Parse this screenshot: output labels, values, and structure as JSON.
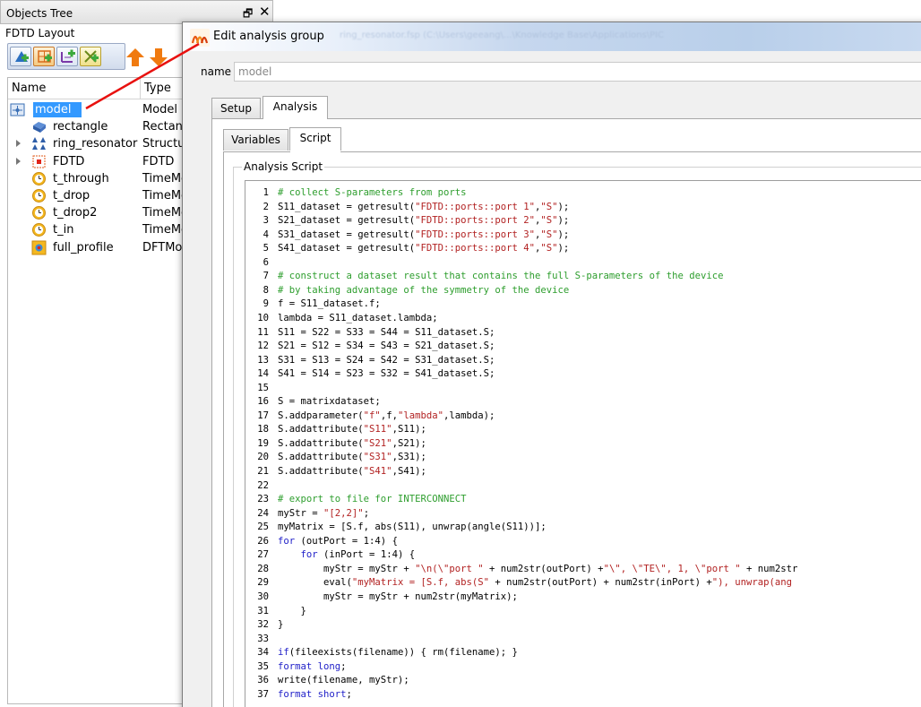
{
  "objects_tree": {
    "title": "Objects Tree",
    "layout_label": "FDTD Layout",
    "columns": {
      "name": "Name",
      "type": "Type"
    },
    "items": [
      {
        "name": "model",
        "type": "Model",
        "selected": true,
        "icon": "model-icon"
      },
      {
        "name": "rectangle",
        "type": "Rectang",
        "icon": "rectangle-icon"
      },
      {
        "name": "ring_resonator",
        "type": "Structur",
        "expandable": true,
        "icon": "structure-group-icon"
      },
      {
        "name": "FDTD",
        "type": "FDTD",
        "expandable": true,
        "icon": "fdtd-icon"
      },
      {
        "name": "t_through",
        "type": "TimeMo",
        "icon": "time-monitor-icon"
      },
      {
        "name": "t_drop",
        "type": "TimeMo",
        "icon": "time-monitor-icon"
      },
      {
        "name": "t_drop2",
        "type": "TimeMo",
        "icon": "time-monitor-icon"
      },
      {
        "name": "t_in",
        "type": "TimeMo",
        "icon": "time-monitor-icon"
      },
      {
        "name": "full_profile",
        "type": "DFTMo",
        "icon": "dft-monitor-icon"
      }
    ]
  },
  "dialog": {
    "title": "Edit analysis group",
    "path_text": "ring_resonator.fsp (C:\\Users\\geeang\\...\\Knowledge Base\\Applications\\PIC",
    "name_label": "name",
    "name_value": "model",
    "tabs": [
      "Setup",
      "Analysis"
    ],
    "active_tab": "Analysis",
    "subtabs": [
      "Variables",
      "Script"
    ],
    "active_subtab": "Script",
    "group_label": "Analysis Script"
  },
  "colors": {
    "comment": "#2e9e2e",
    "string": "#b22222",
    "keyword": "#1f1fc8",
    "selection": "#3399ff",
    "arrow": "#e8110f"
  },
  "script_lines": [
    [
      [
        "c",
        "# collect S-parameters from ports"
      ]
    ],
    [
      [
        "p",
        "S11_dataset = getresult("
      ],
      [
        "s",
        "\"FDTD::ports::port 1\""
      ],
      [
        "p",
        ","
      ],
      [
        "s",
        "\"S\""
      ],
      [
        "p",
        ");"
      ]
    ],
    [
      [
        "p",
        "S21_dataset = getresult("
      ],
      [
        "s",
        "\"FDTD::ports::port 2\""
      ],
      [
        "p",
        ","
      ],
      [
        "s",
        "\"S\""
      ],
      [
        "p",
        ");"
      ]
    ],
    [
      [
        "p",
        "S31_dataset = getresult("
      ],
      [
        "s",
        "\"FDTD::ports::port 3\""
      ],
      [
        "p",
        ","
      ],
      [
        "s",
        "\"S\""
      ],
      [
        "p",
        ");"
      ]
    ],
    [
      [
        "p",
        "S41_dataset = getresult("
      ],
      [
        "s",
        "\"FDTD::ports::port 4\""
      ],
      [
        "p",
        ","
      ],
      [
        "s",
        "\"S\""
      ],
      [
        "p",
        ");"
      ]
    ],
    [],
    [
      [
        "c",
        "# construct a dataset result that contains the full S-parameters of the device"
      ]
    ],
    [
      [
        "c",
        "# by taking advantage of the symmetry of the device"
      ]
    ],
    [
      [
        "p",
        "f = S11_dataset.f;"
      ]
    ],
    [
      [
        "p",
        "lambda = S11_dataset.lambda;"
      ]
    ],
    [
      [
        "p",
        "S11 = S22 = S33 = S44 = S11_dataset.S;"
      ]
    ],
    [
      [
        "p",
        "S21 = S12 = S34 = S43 = S21_dataset.S;"
      ]
    ],
    [
      [
        "p",
        "S31 = S13 = S24 = S42 = S31_dataset.S;"
      ]
    ],
    [
      [
        "p",
        "S41 = S14 = S23 = S32 = S41_dataset.S;"
      ]
    ],
    [],
    [
      [
        "p",
        "S = matrixdataset;"
      ]
    ],
    [
      [
        "p",
        "S.addparameter("
      ],
      [
        "s",
        "\"f\""
      ],
      [
        "p",
        ",f,"
      ],
      [
        "s",
        "\"lambda\""
      ],
      [
        "p",
        ",lambda);"
      ]
    ],
    [
      [
        "p",
        "S.addattribute("
      ],
      [
        "s",
        "\"S11\""
      ],
      [
        "p",
        ",S11);"
      ]
    ],
    [
      [
        "p",
        "S.addattribute("
      ],
      [
        "s",
        "\"S21\""
      ],
      [
        "p",
        ",S21);"
      ]
    ],
    [
      [
        "p",
        "S.addattribute("
      ],
      [
        "s",
        "\"S31\""
      ],
      [
        "p",
        ",S31);"
      ]
    ],
    [
      [
        "p",
        "S.addattribute("
      ],
      [
        "s",
        "\"S41\""
      ],
      [
        "p",
        ",S41);"
      ]
    ],
    [],
    [
      [
        "c",
        "# export to file for INTERCONNECT"
      ]
    ],
    [
      [
        "p",
        "myStr = "
      ],
      [
        "s",
        "\"[2,2]\""
      ],
      [
        "p",
        ";"
      ]
    ],
    [
      [
        "p",
        "myMatrix = [S.f, abs(S11), unwrap(angle(S11))];"
      ]
    ],
    [
      [
        "k",
        "for"
      ],
      [
        "p",
        " (outPort = 1:4) {"
      ]
    ],
    [
      [
        "p",
        "    "
      ],
      [
        "k",
        "for"
      ],
      [
        "p",
        " (inPort = 1:4) {"
      ]
    ],
    [
      [
        "p",
        "        myStr = myStr + "
      ],
      [
        "s",
        "\"\\n(\\\"port \""
      ],
      [
        "p",
        " + num2str(outPort) +"
      ],
      [
        "s",
        "\"\\\", \\\"TE\\\", 1, \\\"port \""
      ],
      [
        "p",
        " + num2str"
      ]
    ],
    [
      [
        "p",
        "        eval("
      ],
      [
        "s",
        "\"myMatrix = [S.f, abs(S\""
      ],
      [
        "p",
        " + num2str(outPort) + num2str(inPort) +"
      ],
      [
        "s",
        "\"), unwrap(ang"
      ]
    ],
    [
      [
        "p",
        "        myStr = myStr + num2str(myMatrix);"
      ]
    ],
    [
      [
        "p",
        "    }"
      ]
    ],
    [
      [
        "p",
        "}"
      ]
    ],
    [],
    [
      [
        "k",
        "if"
      ],
      [
        "p",
        "(fileexists(filename)) { rm(filename); }"
      ]
    ],
    [
      [
        "k",
        "format long"
      ],
      [
        "p",
        ";"
      ]
    ],
    [
      [
        "p",
        "write(filename, myStr);"
      ]
    ],
    [
      [
        "k",
        "format short"
      ],
      [
        "p",
        ";"
      ]
    ]
  ]
}
